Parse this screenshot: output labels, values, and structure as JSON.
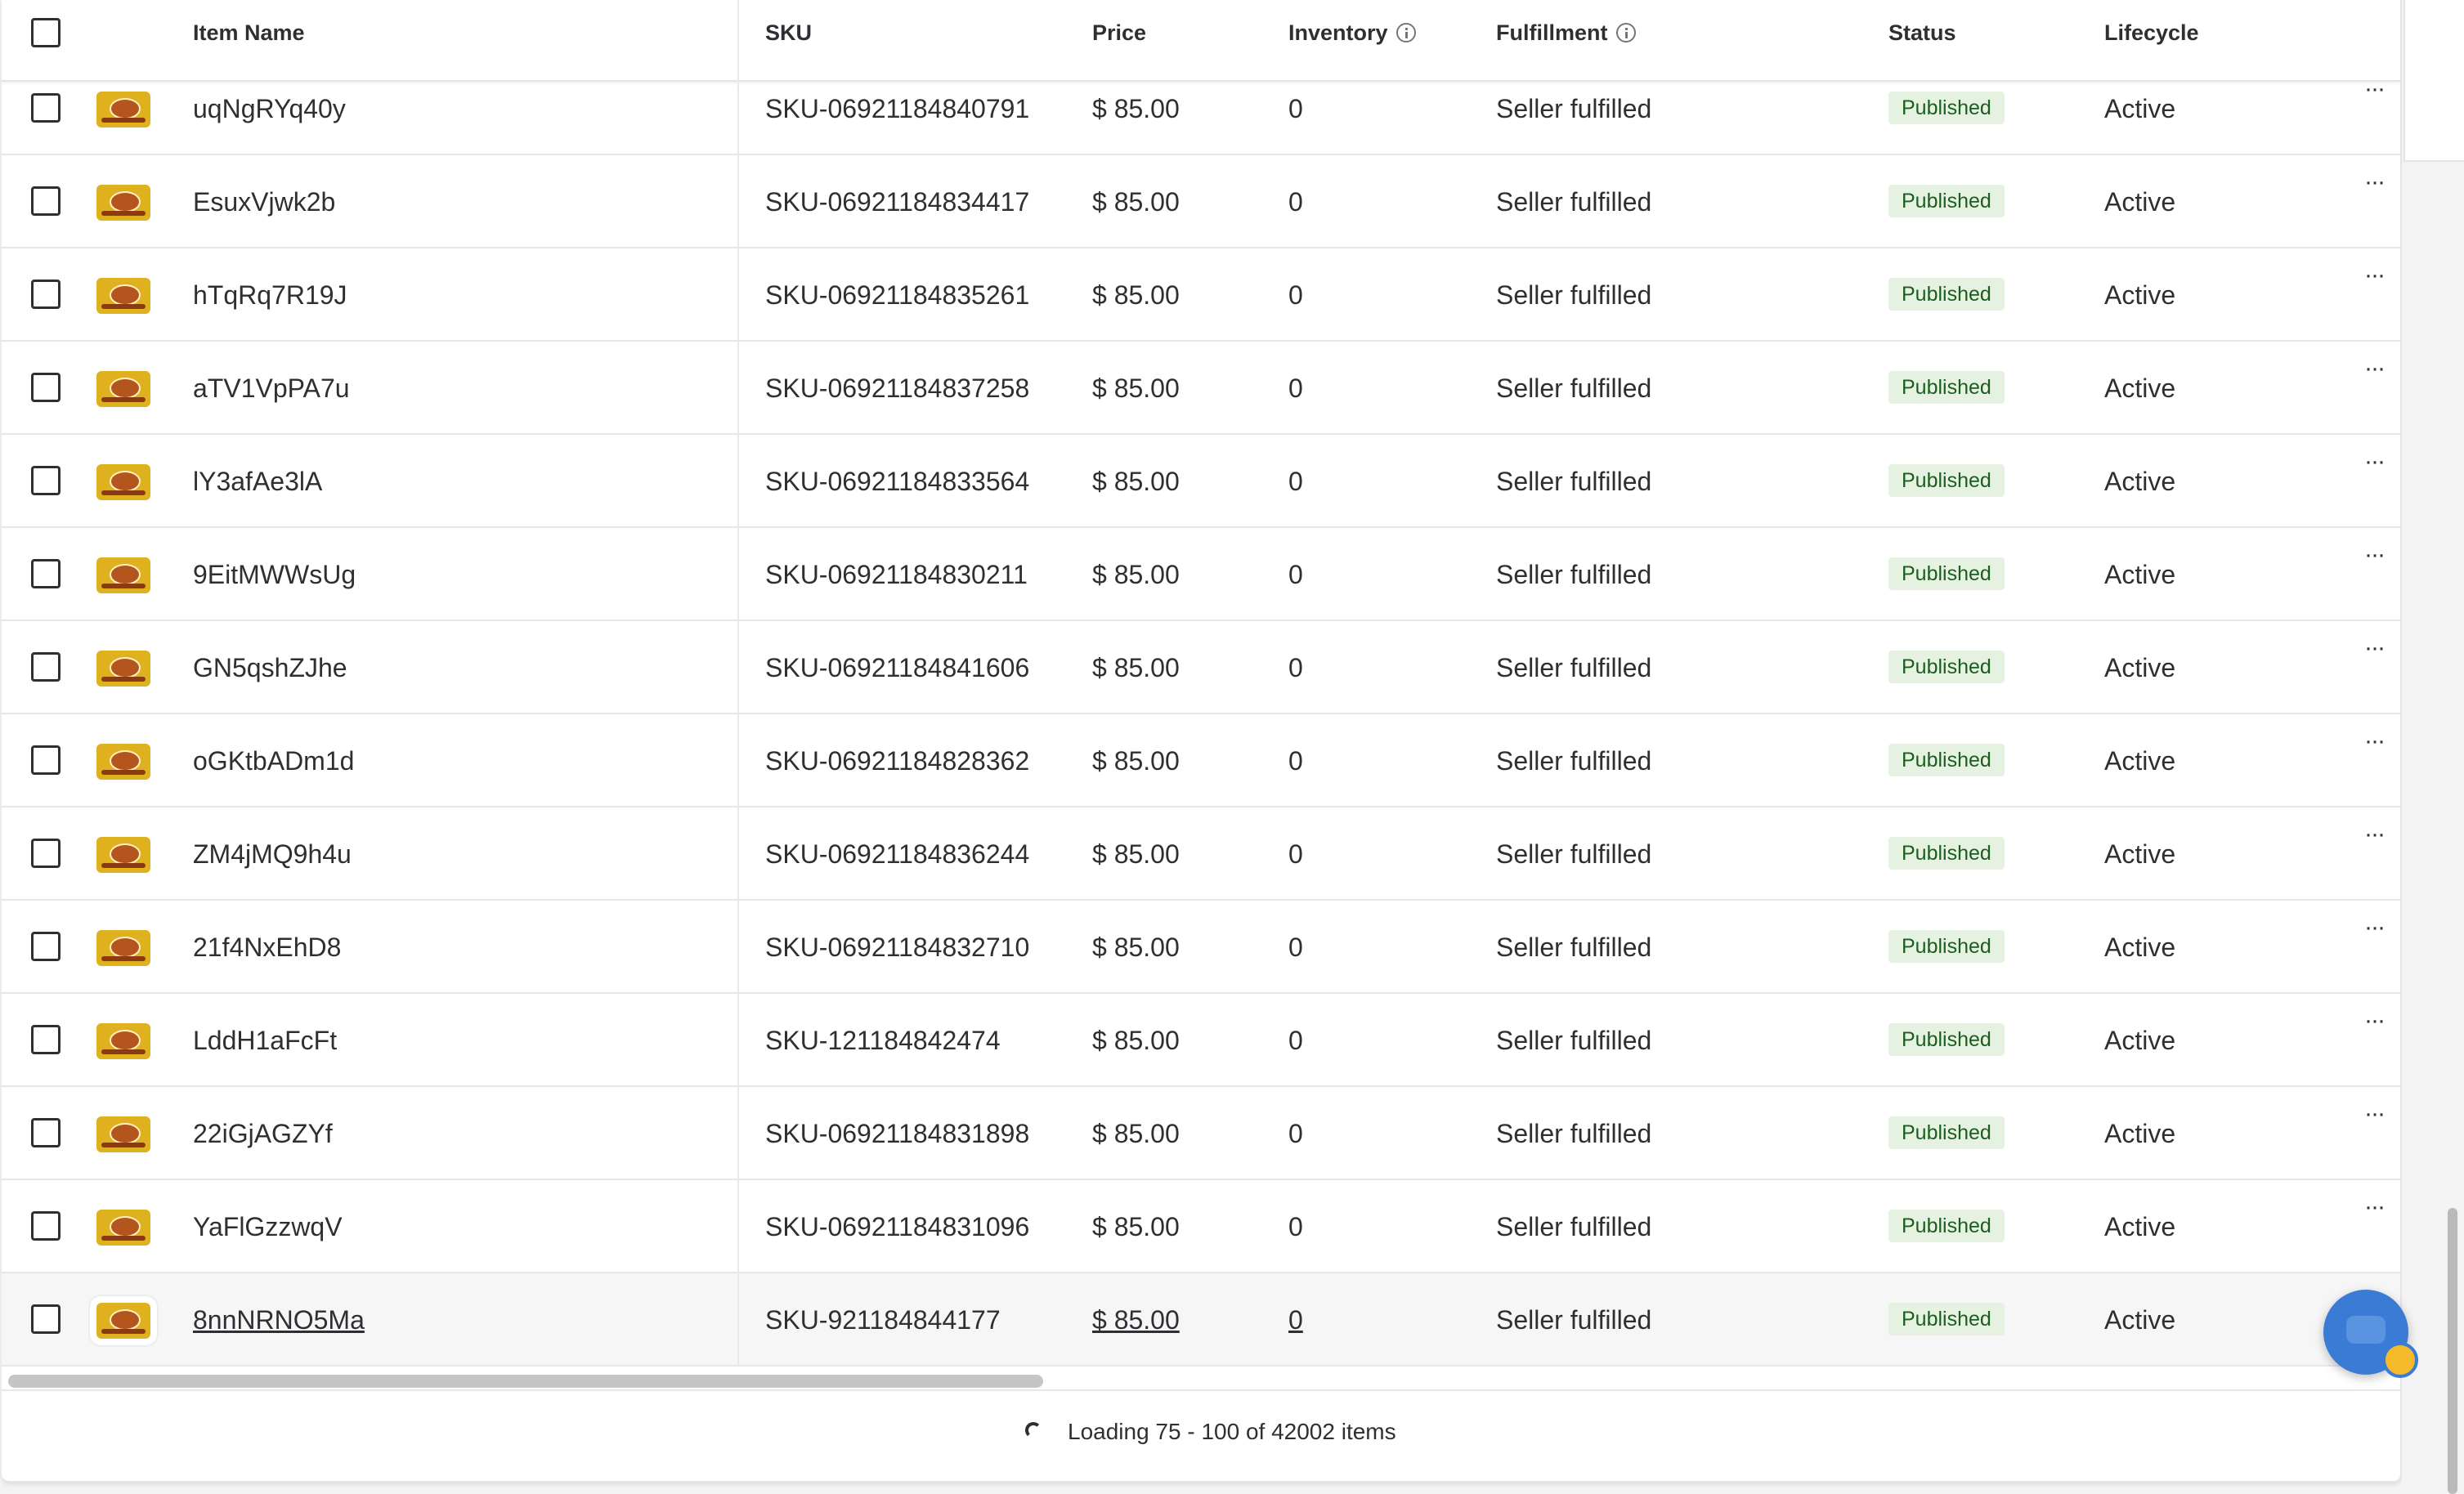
{
  "table": {
    "columns": {
      "item_name": "Item Name",
      "sku": "SKU",
      "price": "Price",
      "inventory": "Inventory",
      "fulfillment": "Fulfillment",
      "status": "Status",
      "lifecycle": "Lifecycle"
    },
    "more_actions_label": "···",
    "rows": [
      {
        "name": "uqNgRYq40y",
        "sku": "SKU-06921184840791",
        "price": "$ 85.00",
        "inventory": "0",
        "fulfillment": "Seller fulfilled",
        "status": "Published",
        "lifecycle": "Active"
      },
      {
        "name": "EsuxVjwk2b",
        "sku": "SKU-06921184834417",
        "price": "$ 85.00",
        "inventory": "0",
        "fulfillment": "Seller fulfilled",
        "status": "Published",
        "lifecycle": "Active"
      },
      {
        "name": "hTqRq7R19J",
        "sku": "SKU-06921184835261",
        "price": "$ 85.00",
        "inventory": "0",
        "fulfillment": "Seller fulfilled",
        "status": "Published",
        "lifecycle": "Active"
      },
      {
        "name": "aTV1VpPA7u",
        "sku": "SKU-06921184837258",
        "price": "$ 85.00",
        "inventory": "0",
        "fulfillment": "Seller fulfilled",
        "status": "Published",
        "lifecycle": "Active"
      },
      {
        "name": "lY3afAe3lA",
        "sku": "SKU-06921184833564",
        "price": "$ 85.00",
        "inventory": "0",
        "fulfillment": "Seller fulfilled",
        "status": "Published",
        "lifecycle": "Active"
      },
      {
        "name": "9EitMWWsUg",
        "sku": "SKU-06921184830211",
        "price": "$ 85.00",
        "inventory": "0",
        "fulfillment": "Seller fulfilled",
        "status": "Published",
        "lifecycle": "Active"
      },
      {
        "name": "GN5qshZJhe",
        "sku": "SKU-06921184841606",
        "price": "$ 85.00",
        "inventory": "0",
        "fulfillment": "Seller fulfilled",
        "status": "Published",
        "lifecycle": "Active"
      },
      {
        "name": "oGKtbADm1d",
        "sku": "SKU-06921184828362",
        "price": "$ 85.00",
        "inventory": "0",
        "fulfillment": "Seller fulfilled",
        "status": "Published",
        "lifecycle": "Active"
      },
      {
        "name": "ZM4jMQ9h4u",
        "sku": "SKU-06921184836244",
        "price": "$ 85.00",
        "inventory": "0",
        "fulfillment": "Seller fulfilled",
        "status": "Published",
        "lifecycle": "Active"
      },
      {
        "name": "21f4NxEhD8",
        "sku": "SKU-06921184832710",
        "price": "$ 85.00",
        "inventory": "0",
        "fulfillment": "Seller fulfilled",
        "status": "Published",
        "lifecycle": "Active"
      },
      {
        "name": "LddH1aFcFt",
        "sku": "SKU-121184842474",
        "price": "$ 85.00",
        "inventory": "0",
        "fulfillment": "Seller fulfilled",
        "status": "Published",
        "lifecycle": "Active"
      },
      {
        "name": "22iGjAGZYf",
        "sku": "SKU-06921184831898",
        "price": "$ 85.00",
        "inventory": "0",
        "fulfillment": "Seller fulfilled",
        "status": "Published",
        "lifecycle": "Active"
      },
      {
        "name": "YaFlGzzwqV",
        "sku": "SKU-06921184831096",
        "price": "$ 85.00",
        "inventory": "0",
        "fulfillment": "Seller fulfilled",
        "status": "Published",
        "lifecycle": "Active"
      },
      {
        "name": "8nnNRNO5Ma",
        "sku": "SKU-921184844177",
        "price": "$ 85.00",
        "inventory": "0",
        "fulfillment": "Seller fulfilled",
        "status": "Published",
        "lifecycle": "Active",
        "hovered": true
      }
    ]
  },
  "footer": {
    "loading_text": "Loading 75 - 100 of 42002 items"
  },
  "icons": {
    "info": "info-circle-icon",
    "more": "more-horizontal-icon",
    "spinner": "loading-spinner-icon",
    "chat": "chat-assistant-icon"
  },
  "colors": {
    "status_badge_bg": "#e6f2e1",
    "status_badge_text": "#1c5e1f",
    "chat_button": "#3a7bd5",
    "text": "#2e2f32"
  }
}
